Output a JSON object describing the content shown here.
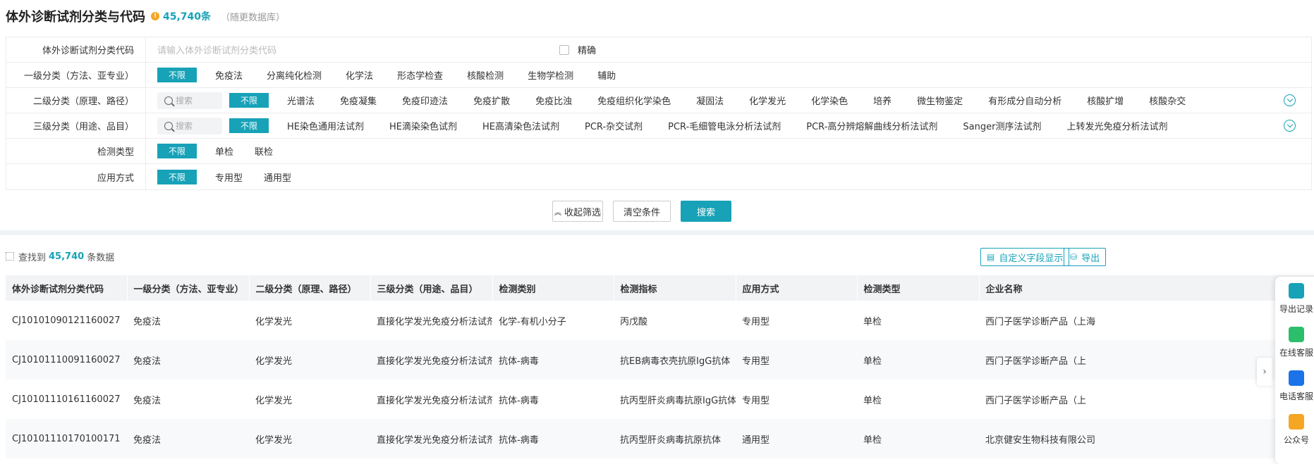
{
  "header": {
    "title": "体外诊断试剂分类与代码",
    "count": "45,740条",
    "db_note": "（随更数据库）"
  },
  "filters": {
    "code": {
      "label": "体外诊断试剂分类代码",
      "placeholder": "请输入体外诊断试剂分类代码",
      "exact_label": "精确"
    },
    "level1": {
      "label": "一级分类（方法、亚专业）",
      "all": "不限",
      "options": [
        "免疫法",
        "分离纯化检测",
        "化学法",
        "形态学检查",
        "核酸检测",
        "生物学检测",
        "辅助"
      ]
    },
    "level2": {
      "label": "二级分类（原理、路径）",
      "search_placeholder": "搜索",
      "all": "不限",
      "options": [
        "光谱法",
        "免疫凝集",
        "免疫印迹法",
        "免疫扩散",
        "免疫比浊",
        "免疫组织化学染色",
        "凝固法",
        "化学发光",
        "化学染色",
        "培养",
        "微生物鉴定",
        "有形成分自动分析",
        "核酸扩增",
        "核酸杂交"
      ]
    },
    "level3": {
      "label": "三级分类（用途、品目）",
      "search_placeholder": "搜索",
      "all": "不限",
      "options": [
        "HE染色通用法试剂",
        "HE滴染染色试剂",
        "HE高清染色法试剂",
        "PCR-杂交试剂",
        "PCR-毛细管电泳分析法试剂",
        "PCR-高分辨熔解曲线分析法试剂",
        "Sanger测序法试剂",
        "上转发光免疫分析法试剂"
      ]
    },
    "test_type": {
      "label": "检测类型",
      "all": "不限",
      "options": [
        "单检",
        "联检"
      ]
    },
    "usage": {
      "label": "应用方式",
      "all": "不限",
      "options": [
        "专用型",
        "通用型"
      ]
    }
  },
  "actions": {
    "collapse": "收起筛选",
    "clear": "清空条件",
    "search": "搜索"
  },
  "results": {
    "prefix": "查找到",
    "count": "45,740",
    "suffix": "条数据",
    "custom_fields": "自定义字段显示",
    "export": "导出"
  },
  "table": {
    "columns": [
      "体外诊断试剂分类代码",
      "一级分类（方法、亚专业）",
      "二级分类（原理、路径）",
      "三级分类（用途、品目）",
      "检测类别",
      "检测指标",
      "应用方式",
      "检测类型",
      "企业名称"
    ],
    "rows": [
      [
        "CJ10101090121160027",
        "免疫法",
        "化学发光",
        "直接化学发光免疫分析法试剂",
        "化学-有机小分子",
        "丙戊酸",
        "专用型",
        "单检",
        "西门子医学诊断产品（上海"
      ],
      [
        "CJ10101110091160027",
        "免疫法",
        "化学发光",
        "直接化学发光免疫分析法试剂",
        "抗体-病毒",
        "抗EB病毒衣壳抗原IgG抗体",
        "专用型",
        "单检",
        "西门子医学诊断产品（上"
      ],
      [
        "CJ10101110161160027",
        "免疫法",
        "化学发光",
        "直接化学发光免疫分析法试剂",
        "抗体-病毒",
        "抗丙型肝炎病毒抗原IgG抗体",
        "专用型",
        "单检",
        "西门子医学诊断产品（上"
      ],
      [
        "CJ10101110170100171",
        "免疫法",
        "化学发光",
        "直接化学发光免疫分析法试剂",
        "抗体-病毒",
        "抗丙型肝炎病毒抗原抗体",
        "通用型",
        "单检",
        "北京健安生物科技有限公司"
      ]
    ]
  },
  "sidebar": {
    "items": [
      {
        "label": "导出记录",
        "icon": "export-record-icon",
        "color": "#17a2b8"
      },
      {
        "label": "在线客服",
        "icon": "chat-icon",
        "color": "#2dbe6c"
      },
      {
        "label": "电话客服",
        "icon": "headset-icon",
        "color": "#1a73e8"
      },
      {
        "label": "公众号",
        "icon": "badge-icon",
        "color": "#f5a623"
      }
    ]
  }
}
